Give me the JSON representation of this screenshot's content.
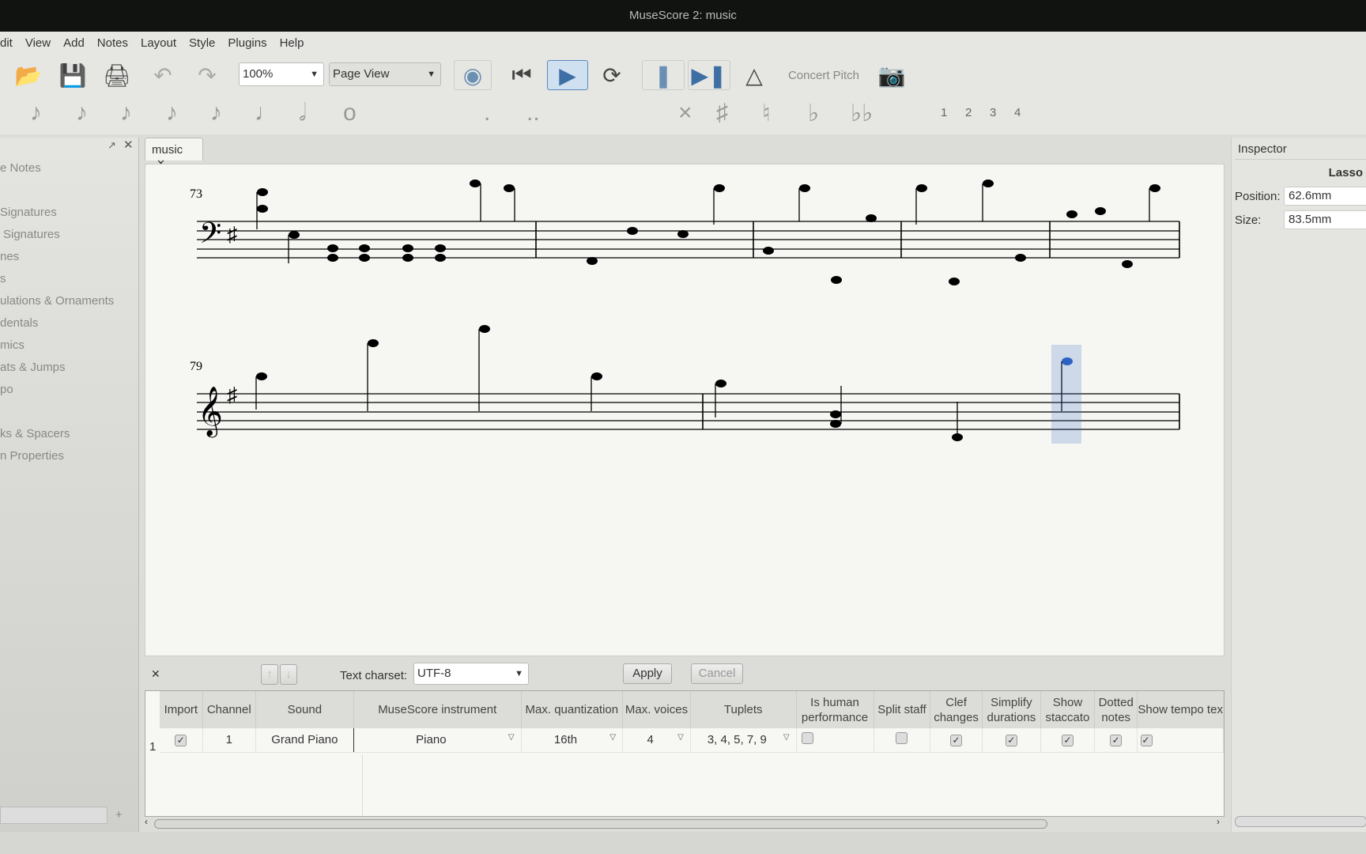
{
  "window": {
    "title": "MuseScore 2: music"
  },
  "menu": [
    "dit",
    "View",
    "Add",
    "Notes",
    "Layout",
    "Style",
    "Plugins",
    "Help"
  ],
  "toolbar": {
    "zoom": "100%",
    "view_mode": "Page View",
    "concert_pitch": "Concert Pitch"
  },
  "palette": {
    "voices": [
      "1",
      "2",
      "3",
      "4"
    ]
  },
  "left_panel": {
    "items": [
      "e Notes",
      "Signatures",
      "Signatures",
      "nes",
      "s",
      "ulations & Ornaments",
      "dentals",
      "mics",
      "ats & Jumps",
      "po",
      "ks & Spacers",
      "n Properties"
    ]
  },
  "score": {
    "tab": "music",
    "measure_numbers": [
      "73",
      "79"
    ]
  },
  "inspector": {
    "title": "Inspector",
    "element": "Lasso",
    "position_label": "Position:",
    "position": "62.6mm",
    "size_label": "Size:",
    "size": "83.5mm"
  },
  "import": {
    "charset_label": "Text charset:",
    "charset": "UTF-8",
    "apply": "Apply",
    "cancel": "Cancel",
    "columns": [
      "Import",
      "Channel",
      "Sound",
      "MuseScore instrument",
      "Max. quantization",
      "Max. voices",
      "Tuplets",
      "Is human performance",
      "Split staff",
      "Clef changes",
      "Simplify durations",
      "Show staccato",
      "Dotted notes",
      "Show tempo tex"
    ],
    "rows": [
      {
        "num": "1",
        "import": true,
        "channel": "1",
        "sound": "Grand Piano",
        "instrument": "Piano",
        "quantization": "16th",
        "voices": "4",
        "tuplets": "3, 4, 5, 7, 9",
        "human": false,
        "split": false,
        "clef": true,
        "simplify": true,
        "staccato": true,
        "dotted": true,
        "tempo": true
      }
    ]
  }
}
